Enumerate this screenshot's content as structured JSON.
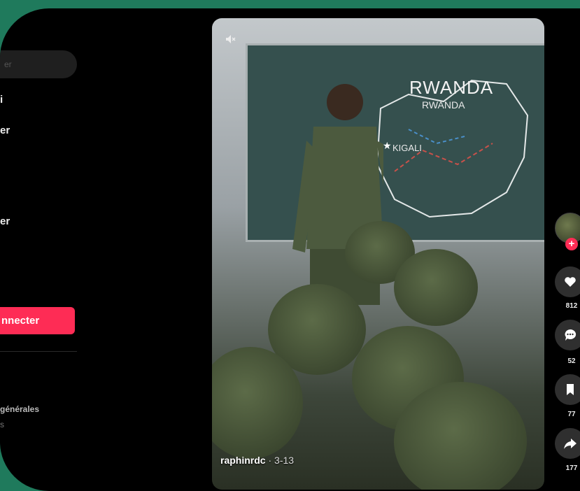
{
  "sidebar": {
    "search_placeholder": "er",
    "nav_items": [
      {
        "label": "i"
      },
      {
        "label": "er"
      },
      {
        "label": "er"
      }
    ],
    "login_label": "nnecter",
    "footer_link": "générales",
    "footer_dot": "s"
  },
  "video": {
    "map_title": "RWANDA",
    "map_subtitle": "RWANDA",
    "map_city": "KIGALI",
    "author": "raphinrdc",
    "date_sep": " · ",
    "date": "3-13"
  },
  "actions": {
    "likes": "812",
    "comments": "52",
    "saves": "77",
    "shares": "177"
  },
  "colors": {
    "accent": "#fe2c55",
    "background_frame": "#1f7a5c"
  }
}
